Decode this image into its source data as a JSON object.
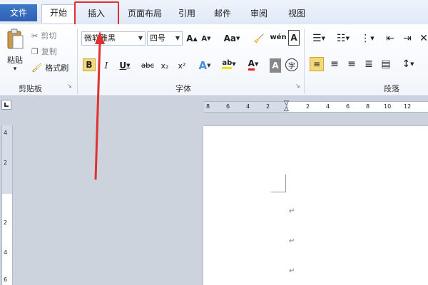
{
  "tabs": {
    "file": "文件",
    "home": "开始",
    "insert": "插入",
    "layout": "页面布局",
    "references": "引用",
    "mailings": "邮件",
    "review": "审阅",
    "view": "视图"
  },
  "clipboard": {
    "paste": "粘贴",
    "cut": "剪切",
    "copy": "复制",
    "format_painter": "格式刷",
    "group_label": "剪贴板"
  },
  "font": {
    "name": "微软雅黑",
    "size": "四号",
    "group_label": "字体",
    "bold": "B",
    "italic": "I",
    "underline": "U",
    "strike": "abc",
    "subscript": "x₂",
    "superscript": "x²",
    "aa": "Aa",
    "phonetic": "wén",
    "enclose": "字"
  },
  "paragraph": {
    "group_label": "段落"
  },
  "ruler": {
    "h_ticks": [
      "8",
      "6",
      "4",
      "2",
      "2",
      "4",
      "6",
      "8",
      "10",
      "12"
    ],
    "v_ticks": [
      "4",
      "2",
      "2",
      "4",
      "6"
    ]
  },
  "colors": {
    "highlight_red": "#e03030",
    "file_tab": "#2f5fb4",
    "bold_active": "#f5d77b"
  }
}
